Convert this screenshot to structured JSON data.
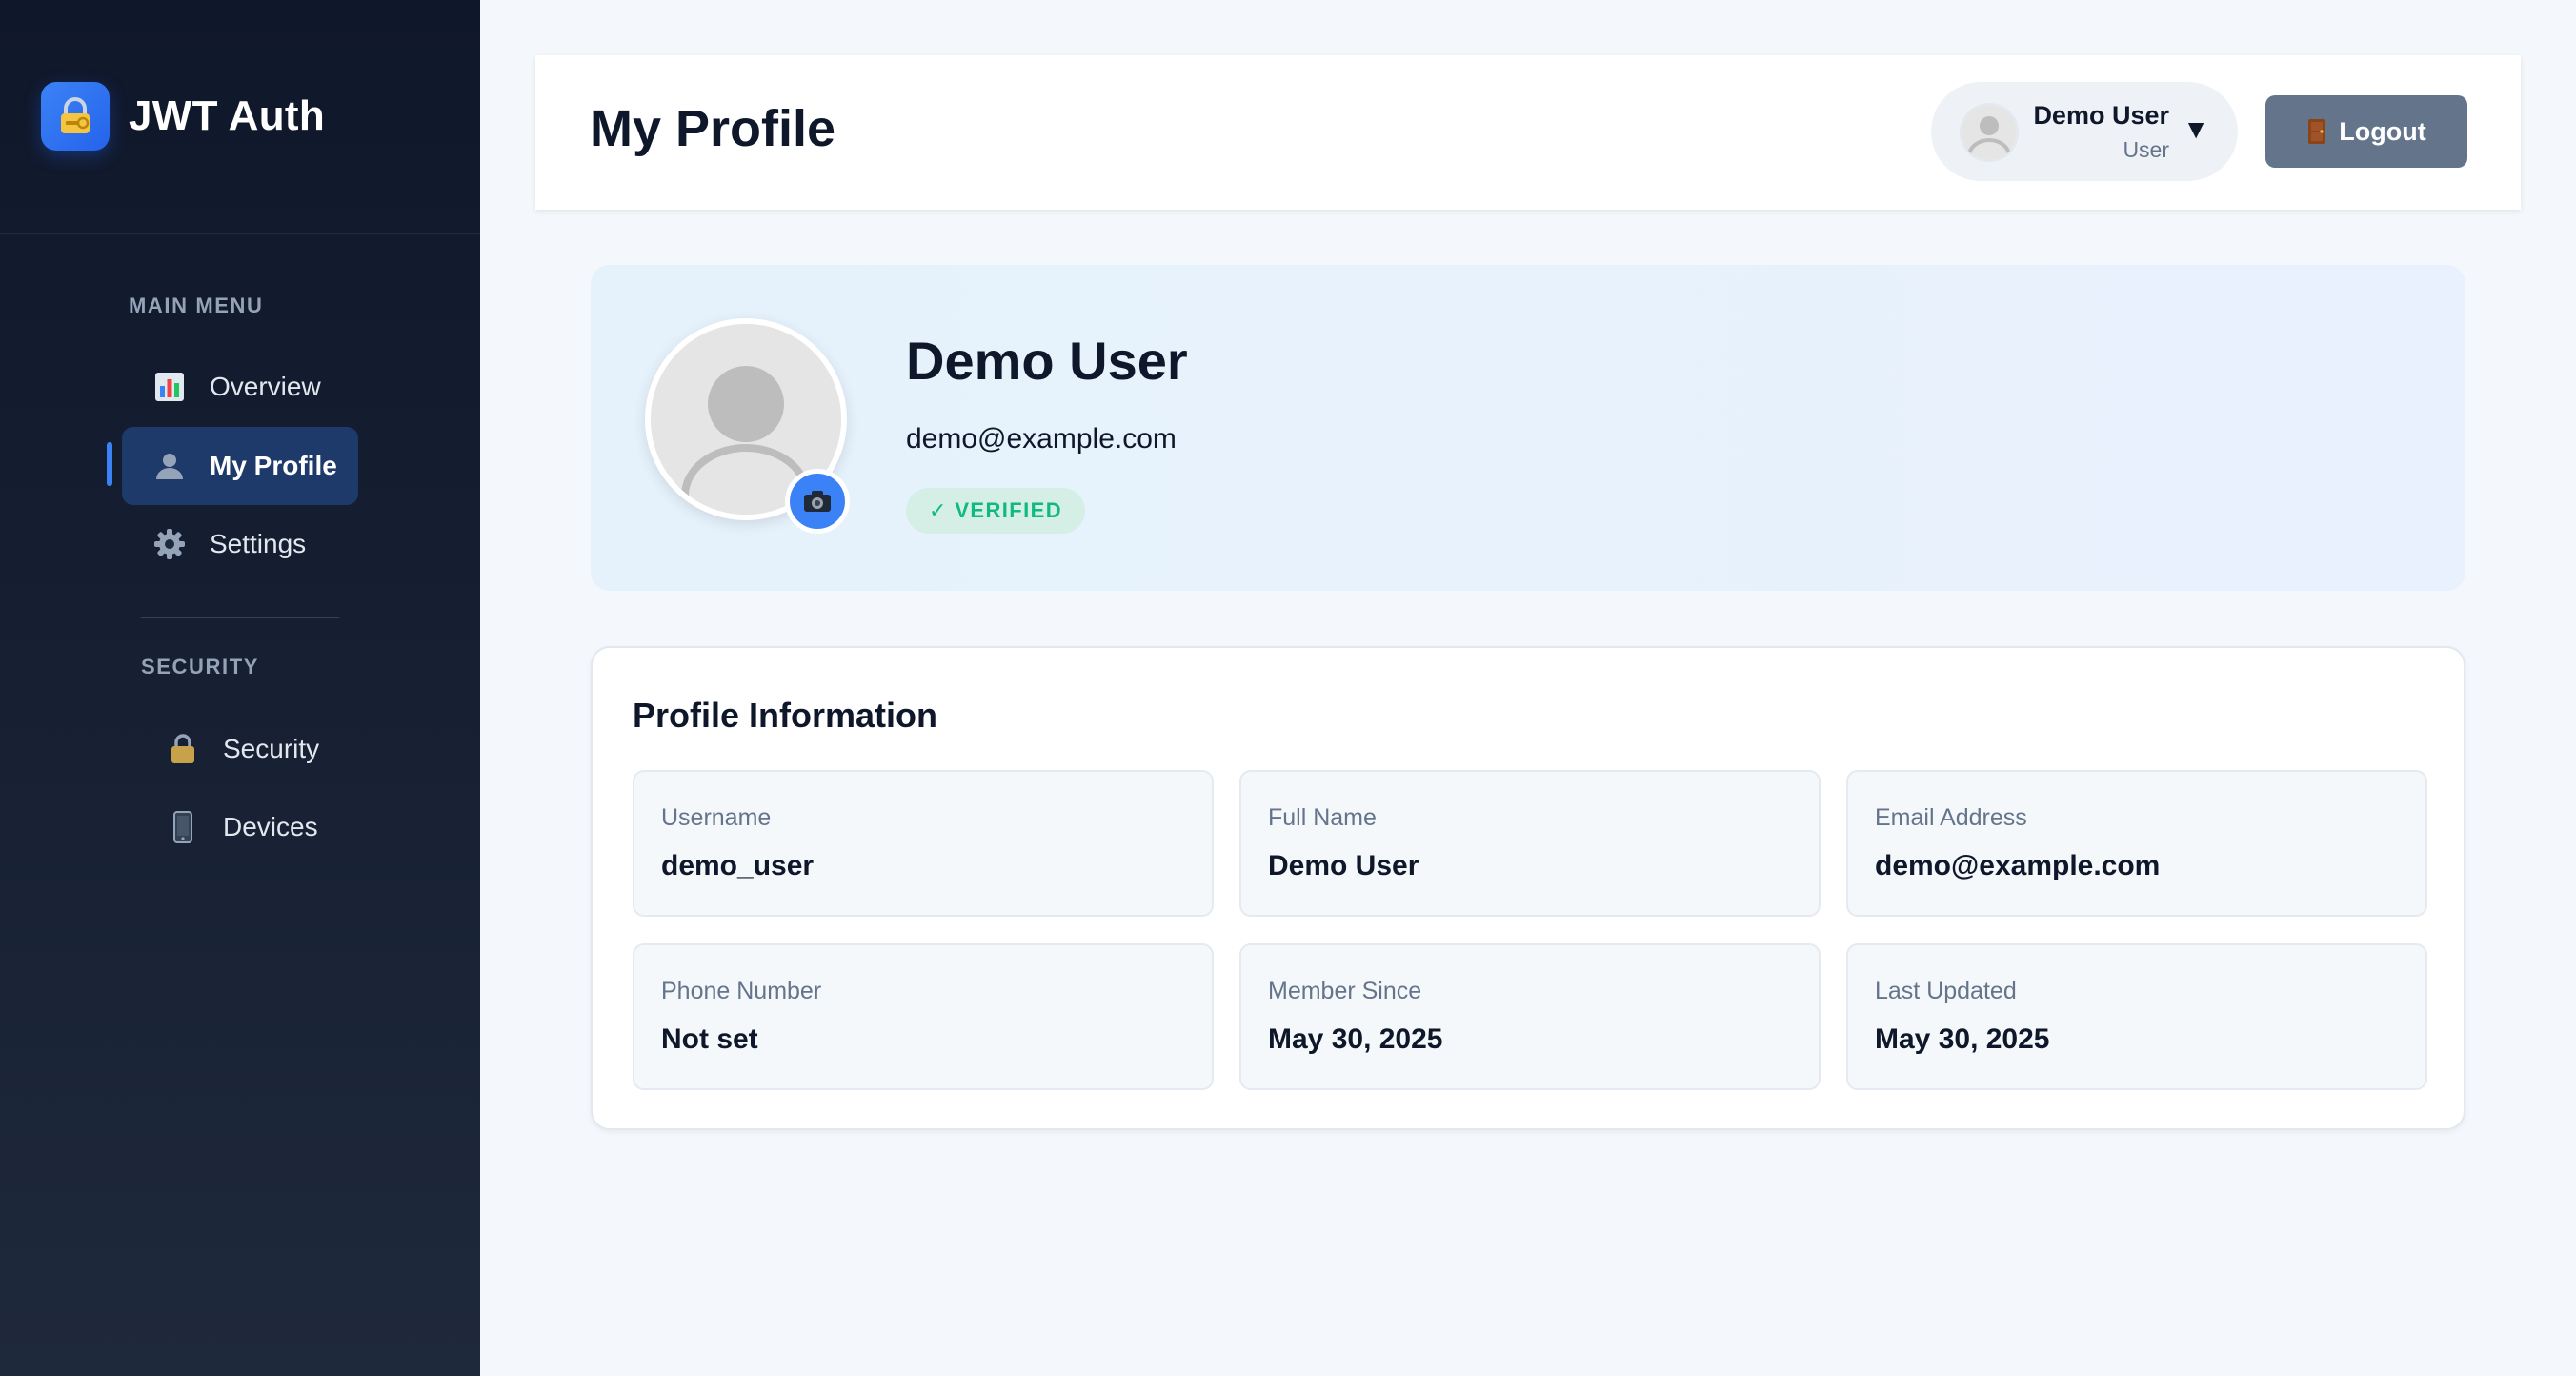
{
  "sidebar": {
    "brand": {
      "title": "JWT Auth",
      "icon": "lock-key-icon"
    },
    "sections": [
      {
        "label": "MAIN MENU",
        "items": [
          {
            "label": "Overview",
            "icon": "bar-chart-icon",
            "active": false
          },
          {
            "label": "My Profile",
            "icon": "user-icon",
            "active": true
          },
          {
            "label": "Settings",
            "icon": "gear-icon",
            "active": false
          }
        ]
      },
      {
        "label": "SECURITY",
        "items": [
          {
            "label": "Security",
            "icon": "lock-icon",
            "active": false
          },
          {
            "label": "Devices",
            "icon": "phone-icon",
            "active": false
          }
        ]
      }
    ]
  },
  "header": {
    "title": "My Profile",
    "user": {
      "name": "Demo User",
      "role": "User",
      "caret": "▼"
    },
    "logout_label": "Logout"
  },
  "profile": {
    "name": "Demo User",
    "email": "demo@example.com",
    "badge": "✓ VERIFIED"
  },
  "info": {
    "title": "Profile Information",
    "fields": [
      {
        "label": "Username",
        "value": "demo_user"
      },
      {
        "label": "Full Name",
        "value": "Demo User"
      },
      {
        "label": "Email Address",
        "value": "demo@example.com"
      },
      {
        "label": "Phone Number",
        "value": "Not set"
      },
      {
        "label": "Member Since",
        "value": "May 30, 2025"
      },
      {
        "label": "Last Updated",
        "value": "May 30, 2025"
      }
    ]
  },
  "colors": {
    "sidebar_bg": "#0f172a",
    "accent": "#3b82f6",
    "active_item_bg": "#1e3a6b",
    "logout_bg": "#64748b",
    "verified_text": "#10b981",
    "verified_bg": "#d5efe6"
  }
}
